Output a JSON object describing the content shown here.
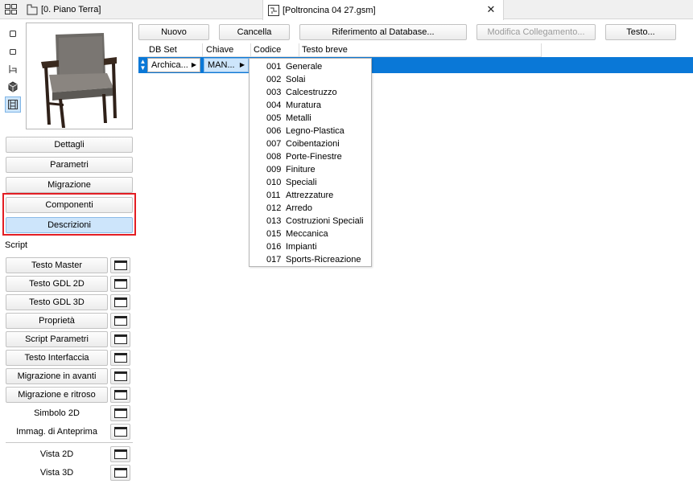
{
  "tabs": [
    {
      "label": "[0. Piano Terra]",
      "icon": "floor-plan-icon"
    },
    {
      "label": "[Poltroncina 04 27.gsm]",
      "icon": "gsm-object-icon"
    }
  ],
  "side_icons": [
    "2d-symbol-icon",
    "3d-view-icon",
    "chair-view-icon",
    "cube-icon",
    "film-strip-icon"
  ],
  "left_buttons": {
    "details": "Dettagli",
    "parameters": "Parametri",
    "migration": "Migrazione",
    "components": "Componenti",
    "descriptions": "Descrizioni"
  },
  "script_label": "Script",
  "script_buttons": [
    "Testo Master",
    "Testo GDL 2D",
    "Testo GDL 3D",
    "Proprietà",
    "Script Parametri",
    "Testo Interfaccia",
    "Migrazione in avanti",
    "Migrazione e ritroso"
  ],
  "script_labels": [
    "Simbolo 2D",
    "Immag. di Anteprima",
    "Vista 2D",
    "Vista 3D"
  ],
  "toolbar": {
    "new": "Nuovo",
    "delete": "Cancella",
    "db_reference": "Riferimento al Database...",
    "modify_link": "Modifica Collegamento...",
    "text": "Testo..."
  },
  "table": {
    "headers": [
      "DB Set",
      "Chiave",
      "Codice",
      "Testo breve"
    ],
    "row": {
      "db_set": "Archica...",
      "key": "MAN..."
    }
  },
  "dropdown_items": [
    {
      "code": "001",
      "name": "Generale"
    },
    {
      "code": "002",
      "name": "Solai"
    },
    {
      "code": "003",
      "name": "Calcestruzzo"
    },
    {
      "code": "004",
      "name": "Muratura"
    },
    {
      "code": "005",
      "name": "Metalli"
    },
    {
      "code": "006",
      "name": "Legno-Plastica"
    },
    {
      "code": "007",
      "name": "Coibentazioni"
    },
    {
      "code": "008",
      "name": "Porte-Finestre"
    },
    {
      "code": "009",
      "name": "Finiture"
    },
    {
      "code": "010",
      "name": "Speciali"
    },
    {
      "code": "011",
      "name": "Attrezzature"
    },
    {
      "code": "012",
      "name": "Arredo"
    },
    {
      "code": "013",
      "name": "Costruzioni Speciali"
    },
    {
      "code": "015",
      "name": "Meccanica"
    },
    {
      "code": "016",
      "name": "Impianti"
    },
    {
      "code": "017",
      "name": "Sports-Ricreazione"
    }
  ],
  "colors": {
    "selection": "#0a78d7",
    "highlight_border": "#e31e24",
    "selected_button": "#cde5fb"
  }
}
